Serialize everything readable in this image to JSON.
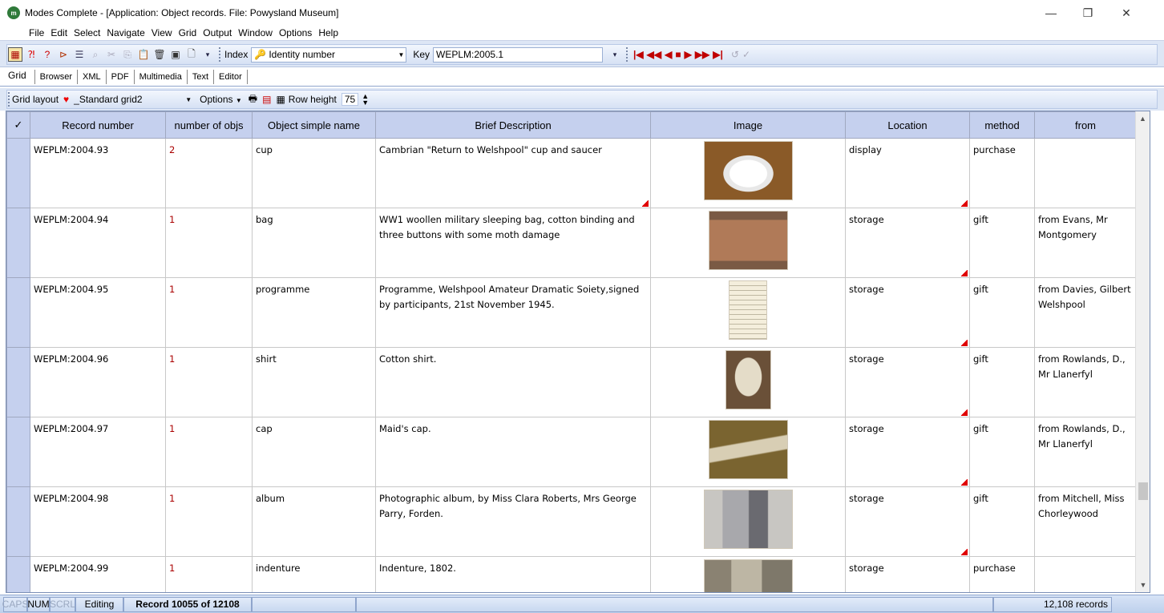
{
  "window": {
    "title": "Modes Complete - [Application: Object records. File: Powysland Museum]",
    "icon_text": "m"
  },
  "menu": [
    "File",
    "Edit",
    "Select",
    "Navigate",
    "View",
    "Grid",
    "Output",
    "Window",
    "Options",
    "Help"
  ],
  "toolbar": {
    "index_label": "Index",
    "index_value": "Identity number",
    "key_label": "Key",
    "key_value": "WEPLM:2005.1"
  },
  "tabs": [
    "Grid",
    "Browser",
    "XML",
    "PDF",
    "Multimedia",
    "Text",
    "Editor"
  ],
  "gridbar": {
    "layout_label": "Grid layout",
    "layout_value": "_Standard grid2",
    "options_label": "Options",
    "row_height_label": "Row height",
    "row_height_value": "75"
  },
  "grid": {
    "check_header": "✓",
    "columns": [
      "Record number",
      "number of objs",
      "Object simple name",
      "Brief Description",
      "Image",
      "Location",
      "method",
      "from"
    ],
    "rows": [
      {
        "record": "WEPLM:2004.93",
        "num": "2",
        "name": "cup",
        "desc": "Cambrian \"Return to Welshpool\" cup and saucer",
        "image": "cup-and-saucer-photo",
        "loc": "display",
        "method": "purchase",
        "from": ""
      },
      {
        "record": "WEPLM:2004.94",
        "num": "1",
        "name": "bag",
        "desc": "WW1 woollen military sleeping bag, cotton binding and three buttons with some moth damage",
        "image": "sleeping-bag-photo",
        "loc": "storage",
        "method": "gift",
        "from": "from Evans, Mr Montgomery"
      },
      {
        "record": "WEPLM:2004.95",
        "num": "1",
        "name": "programme",
        "desc": "Programme, Welshpool Amateur Dramatic Soiety,signed by participants, 21st November 1945.",
        "image": "programme-photo",
        "loc": "storage",
        "method": "gift",
        "from": "from Davies, Gilbert Welshpool"
      },
      {
        "record": "WEPLM:2004.96",
        "num": "1",
        "name": "shirt",
        "desc": "Cotton shirt.",
        "image": "shirt-photo",
        "loc": "storage",
        "method": "gift",
        "from": "from Rowlands, D., Mr Llanerfyl"
      },
      {
        "record": "WEPLM:2004.97",
        "num": "1",
        "name": "cap",
        "desc": "Maid's cap.",
        "image": "cap-photo",
        "loc": "storage",
        "method": "gift",
        "from": "from Rowlands, D., Mr Llanerfyl"
      },
      {
        "record": "WEPLM:2004.98",
        "num": "1",
        "name": "album",
        "desc": "Photographic album, by Miss Clara Roberts, Mrs George Parry, Forden.",
        "image": "album-photo",
        "loc": "storage",
        "method": "gift",
        "from": "from Mitchell, Miss Chorleywood"
      },
      {
        "record": "WEPLM:2004.99",
        "num": "1",
        "name": "indenture",
        "desc": "Indenture, 1802.",
        "image": "indenture-photo",
        "loc": "storage",
        "method": "purchase",
        "from": ""
      }
    ]
  },
  "status": {
    "caps": "CAPS",
    "num": "NUM",
    "scrl": "SCRL",
    "mode": "Editing",
    "record_pos": "Record 10055 of 12108",
    "total": "12,108 records"
  },
  "colors": {
    "header_bg": "#c5d0ee",
    "toolbar_bg": "#dde6f5",
    "nav_red": "#c00000"
  }
}
